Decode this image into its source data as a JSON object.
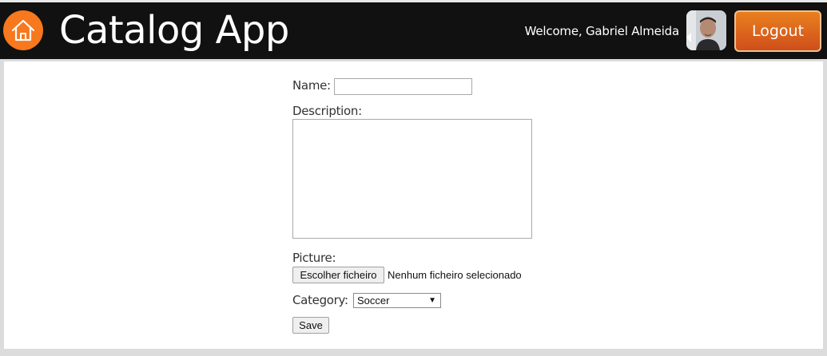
{
  "header": {
    "app_title": "Catalog App",
    "home_icon": "home-icon",
    "welcome_text": "Welcome, Gabriel Almeida",
    "logout_label": "Logout",
    "colors": {
      "bar": "#111111",
      "home": "#f7781d",
      "logout_top": "#e9801e",
      "logout_bottom": "#cf4e1c"
    }
  },
  "form": {
    "name_label": "Name:",
    "name_value": "",
    "description_label": "Description:",
    "description_value": "",
    "picture_label": "Picture:",
    "file_button_label": "Escolher ficheiro",
    "file_status": "Nenhum ficheiro selecionado",
    "category_label": "Category:",
    "category_selected": "Soccer",
    "save_label": "Save"
  }
}
